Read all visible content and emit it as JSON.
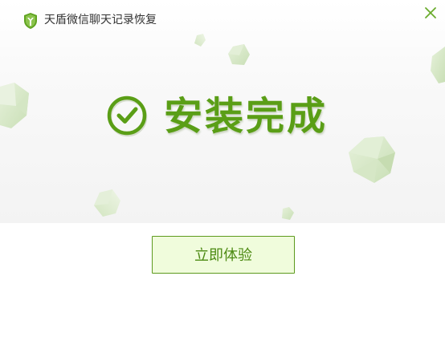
{
  "window": {
    "title": "天盾微信聊天记录恢复",
    "logo_icon": "green-shield-logo-icon",
    "close_icon": "close-icon"
  },
  "status": {
    "icon": "check-circle-icon",
    "message": "安装完成"
  },
  "actions": {
    "start_label": "立即体验"
  },
  "colors": {
    "accent": "#5a9e16",
    "button_bg": "#f0fcdc",
    "button_border": "#5d9a1e",
    "close": "#6aab2c",
    "hero_bg": "#f3f3f3"
  }
}
